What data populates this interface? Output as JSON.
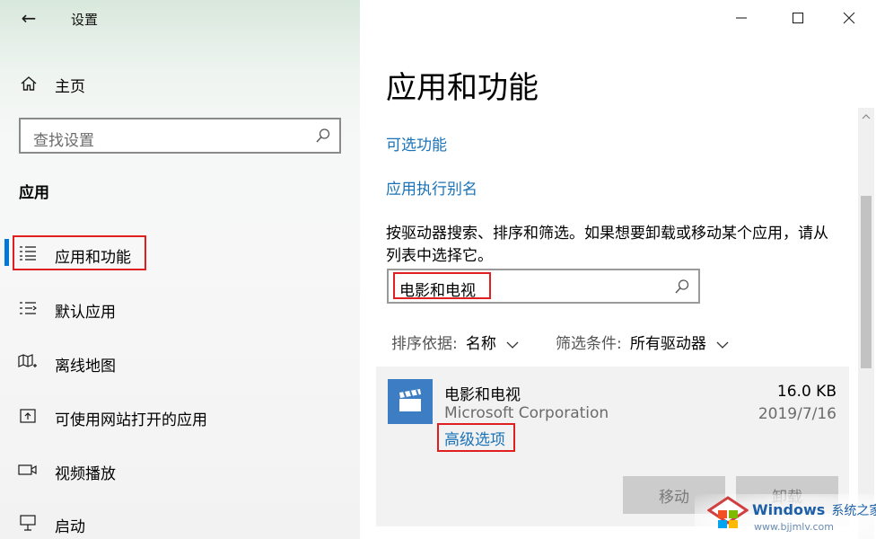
{
  "window": {
    "title": "设置",
    "back_glyph": "←",
    "minimize_glyph": "—",
    "maximize_glyph": "☐",
    "close_glyph": "✕"
  },
  "sidebar": {
    "home_label": "主页",
    "search": {
      "placeholder": "查找设置"
    },
    "section_title": "应用",
    "items": [
      {
        "label": "应用和功能",
        "icon": "apps-features-icon",
        "selected": true
      },
      {
        "label": "默认应用",
        "icon": "default-apps-icon"
      },
      {
        "label": "离线地图",
        "icon": "offline-maps-icon"
      },
      {
        "label": "可使用网站打开的应用",
        "icon": "apps-for-websites-icon"
      },
      {
        "label": "视频播放",
        "icon": "video-playback-icon"
      },
      {
        "label": "启动",
        "icon": "startup-icon"
      }
    ],
    "accent_color": "#0078d7",
    "highlight_color": "#e02020"
  },
  "main": {
    "page_title": "应用和功能",
    "links": {
      "optional_features": "可选功能",
      "app_aliases": "应用执行别名"
    },
    "description_line1": "按驱动器搜索、排序和筛选。如果想要卸载或移动某个应用，请从",
    "description_line2": "列表中选择它。",
    "search": {
      "value": "电影和电视"
    },
    "sort": {
      "label": "排序依据:",
      "value": "名称"
    },
    "filter": {
      "label": "筛选条件:",
      "value": "所有驱动器"
    },
    "app": {
      "name": "电影和电视",
      "publisher": "Microsoft Corporation",
      "size": "16.0 KB",
      "date": "2019/7/16",
      "advanced_link": "高级选项",
      "move_button": "移动",
      "uninstall_button": "卸载",
      "icon_color": "#3d7dc4"
    },
    "link_color": "#1a73b8"
  },
  "watermark": {
    "brand": "Windows",
    "suffix": "系统之家",
    "url": "www.bjjmlv.com"
  }
}
